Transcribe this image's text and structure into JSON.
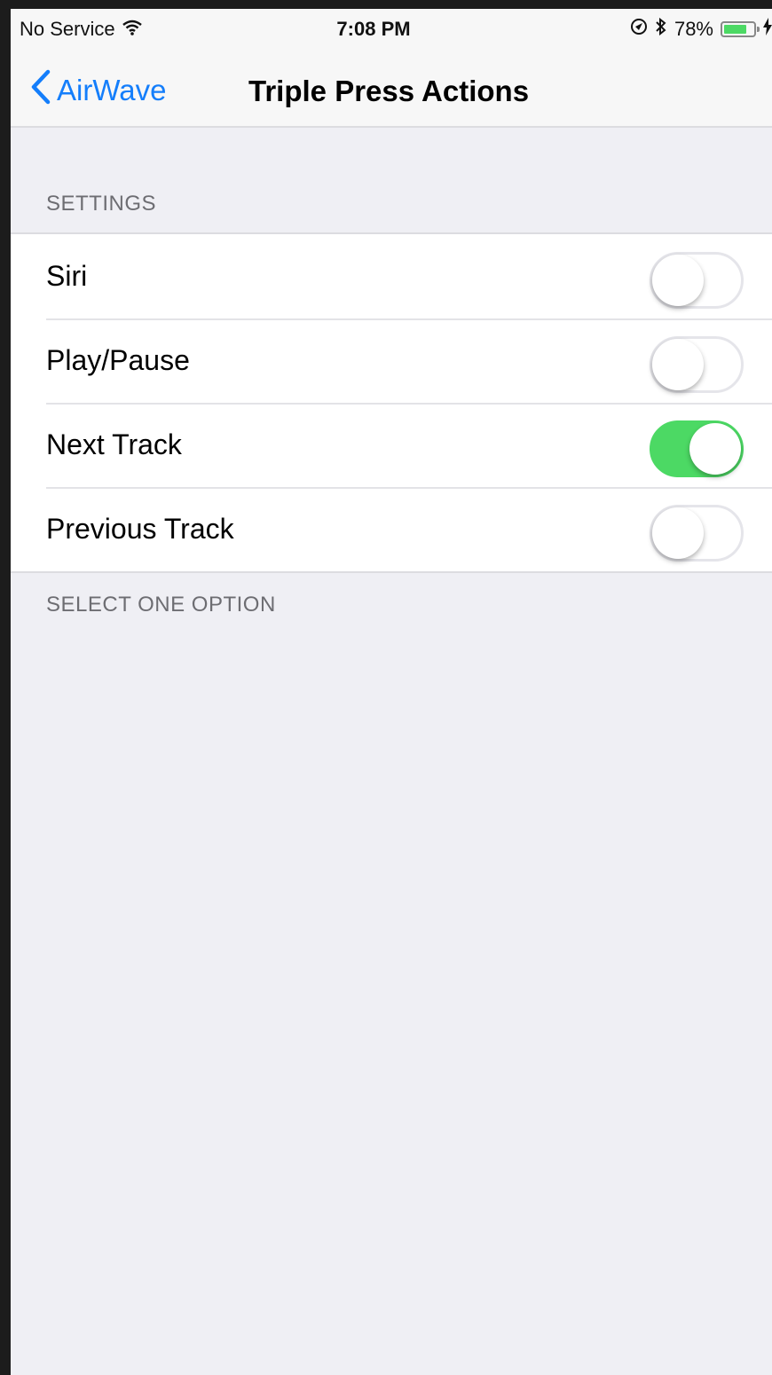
{
  "status_bar": {
    "carrier": "No Service",
    "time": "7:08 PM",
    "battery_percent": "78%",
    "battery_level": 0.78,
    "icons": [
      "wifi-icon",
      "location-icon",
      "bluetooth-icon",
      "battery-icon",
      "charging-icon"
    ]
  },
  "nav": {
    "back_label": "AirWave",
    "title": "Triple Press Actions"
  },
  "settings": {
    "header": "SETTINGS",
    "footer": "SELECT ONE OPTION",
    "items": [
      {
        "label": "Siri",
        "on": false
      },
      {
        "label": "Play/Pause",
        "on": false
      },
      {
        "label": "Next Track",
        "on": true
      },
      {
        "label": "Previous Track",
        "on": false
      }
    ]
  },
  "colors": {
    "accent": "#147efb",
    "toggle_on": "#4cd964",
    "background": "#efeff4"
  }
}
